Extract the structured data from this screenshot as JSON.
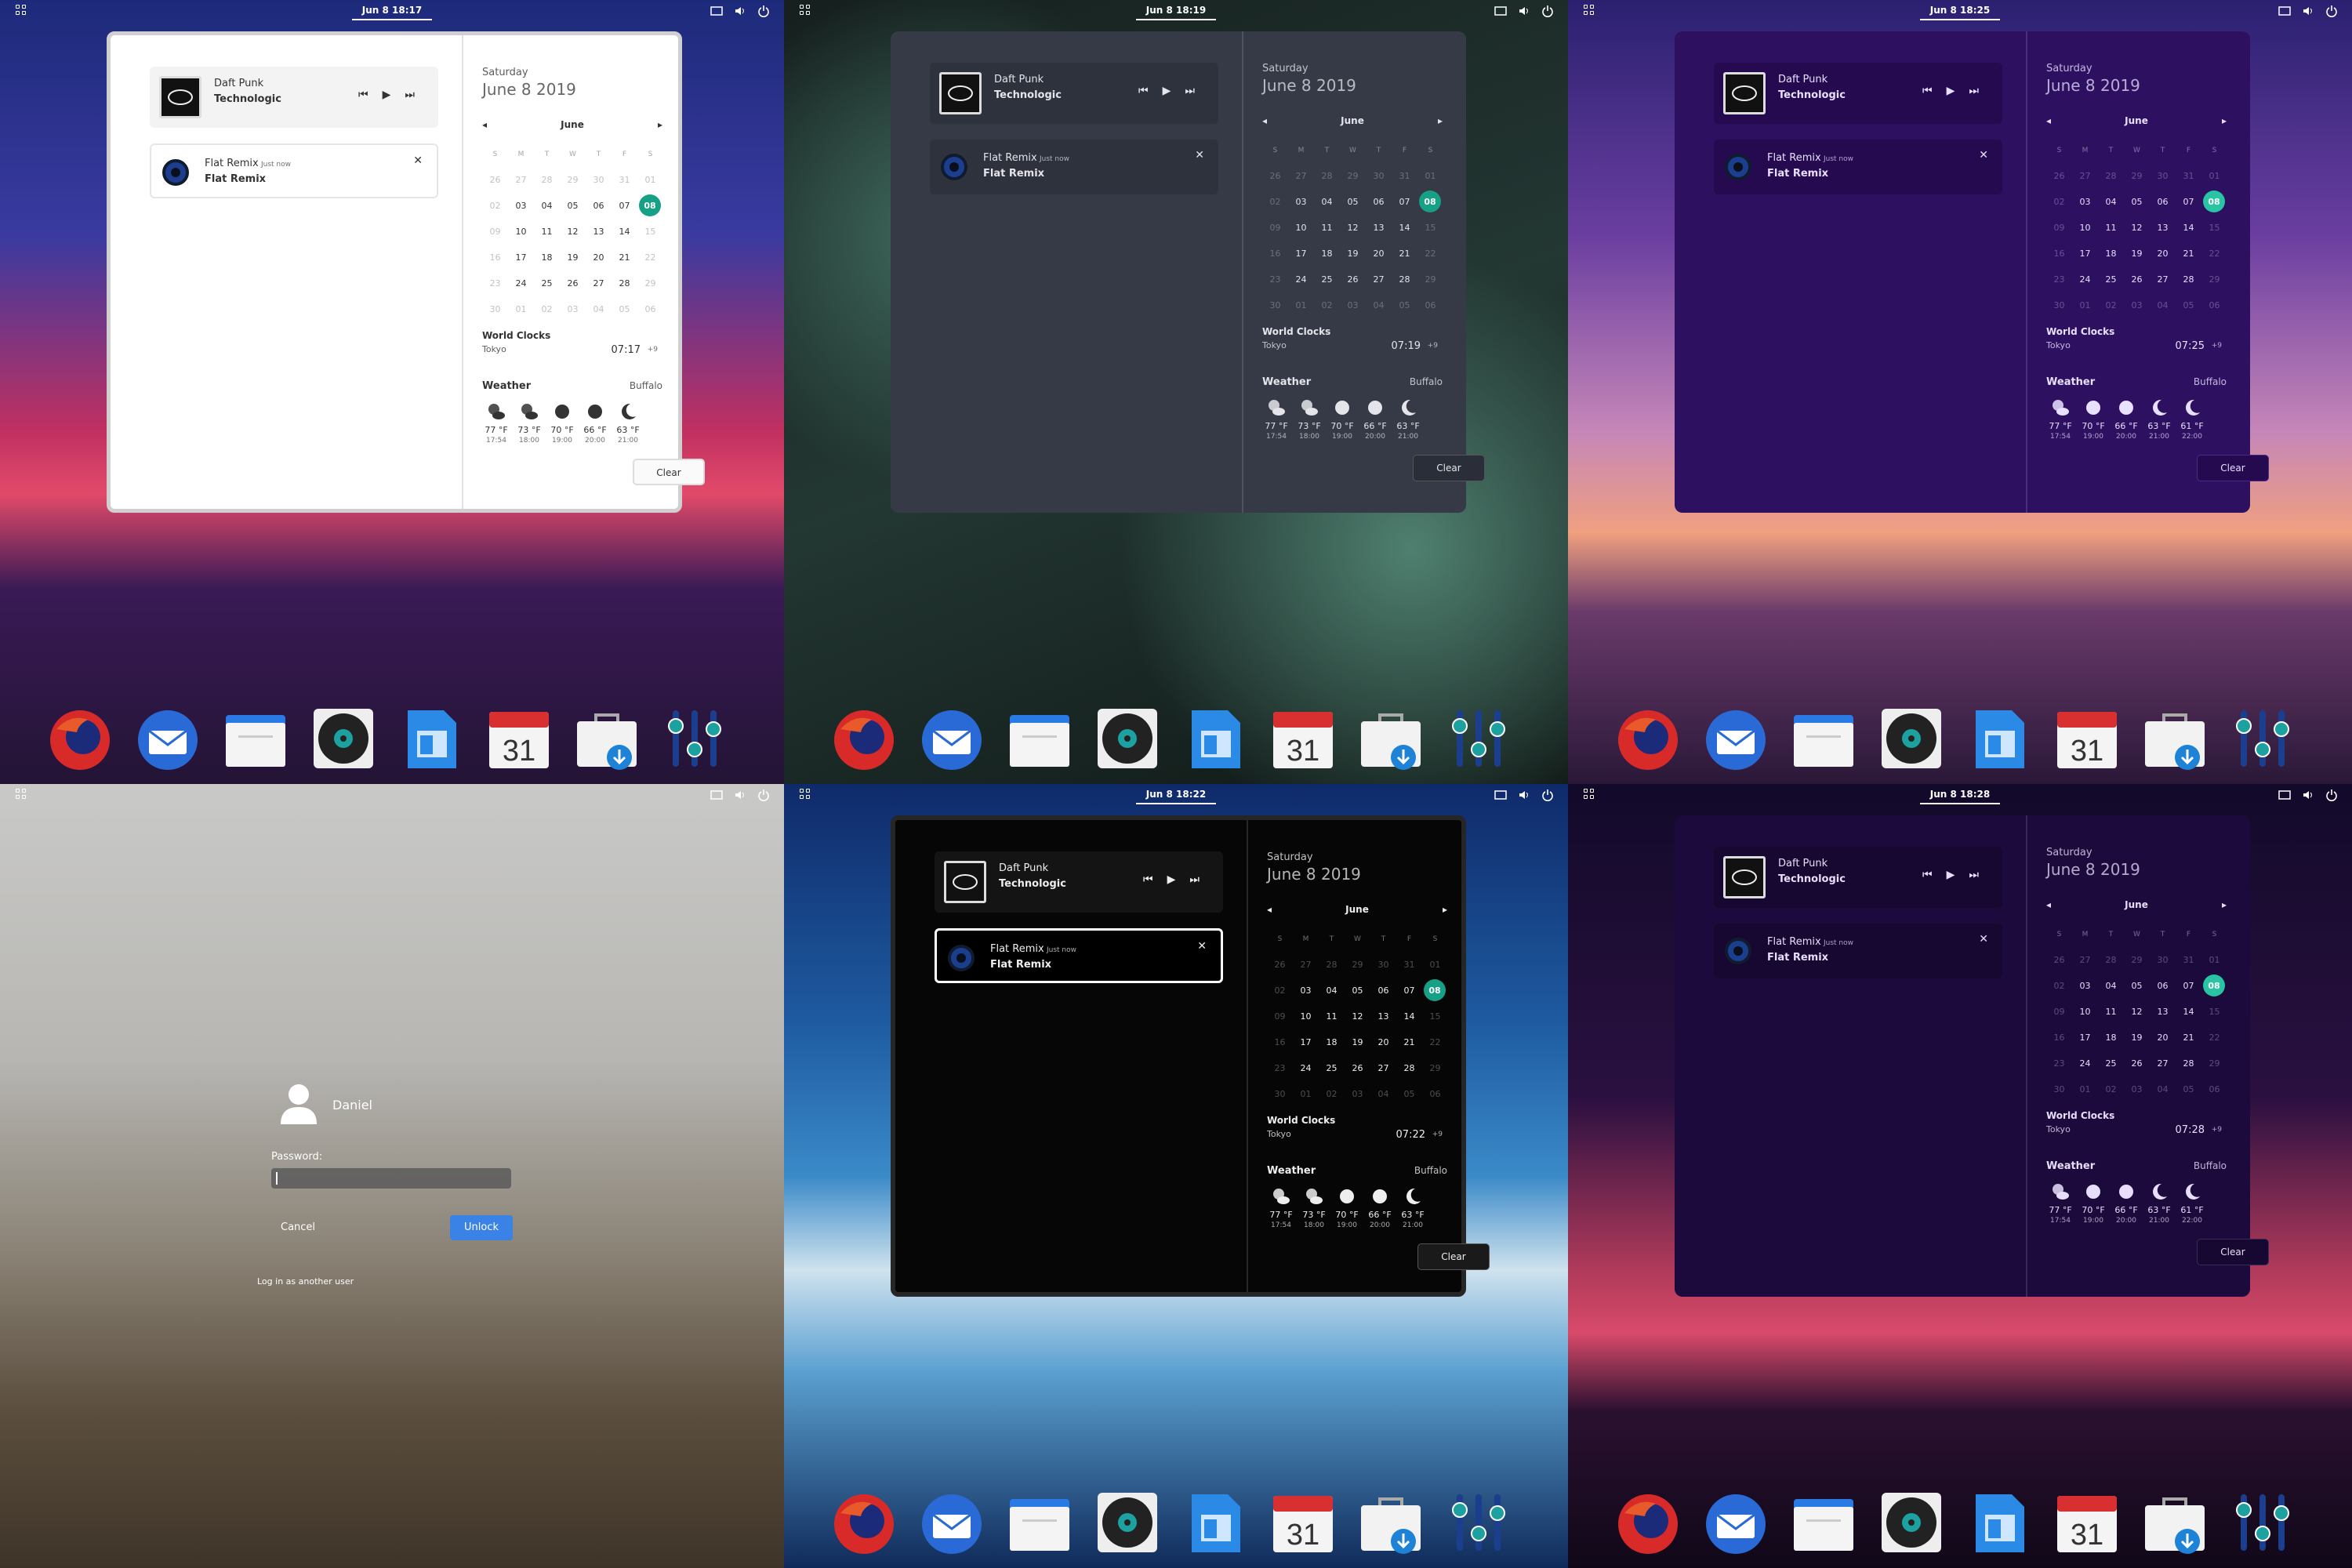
{
  "screens": [
    {
      "theme": "light",
      "clock": "Jun 8  18:17",
      "wc_time": "07:17",
      "weather": [
        {
          "icon": "cloud-sun",
          "temp": "77 °F",
          "hour": "17:54"
        },
        {
          "icon": "cloud-sun",
          "temp": "73 °F",
          "hour": "18:00"
        },
        {
          "icon": "sun",
          "temp": "70 °F",
          "hour": "19:00"
        },
        {
          "icon": "sun",
          "temp": "66 °F",
          "hour": "20:00"
        },
        {
          "icon": "moon",
          "temp": "63 °F",
          "hour": "21:00"
        }
      ]
    },
    {
      "theme": "gray",
      "clock": "Jun 8  18:19",
      "wc_time": "07:19",
      "weather": [
        {
          "icon": "cloud-sun",
          "temp": "77 °F",
          "hour": "17:54"
        },
        {
          "icon": "cloud-sun",
          "temp": "73 °F",
          "hour": "18:00"
        },
        {
          "icon": "sun",
          "temp": "70 °F",
          "hour": "19:00"
        },
        {
          "icon": "sun",
          "temp": "66 °F",
          "hour": "20:00"
        },
        {
          "icon": "moon",
          "temp": "63 °F",
          "hour": "21:00"
        }
      ]
    },
    {
      "theme": "purple",
      "clock": "Jun 8  18:25",
      "wc_time": "07:25",
      "weather": [
        {
          "icon": "cloud-sun",
          "temp": "77 °F",
          "hour": "17:54"
        },
        {
          "icon": "sun",
          "temp": "70 °F",
          "hour": "19:00"
        },
        {
          "icon": "sun",
          "temp": "66 °F",
          "hour": "20:00"
        },
        {
          "icon": "moon",
          "temp": "63 °F",
          "hour": "21:00"
        },
        {
          "icon": "moon",
          "temp": "61 °F",
          "hour": "22:00"
        }
      ]
    },
    {
      "theme": "lock"
    },
    {
      "theme": "black",
      "clock": "Jun 8  18:22",
      "wc_time": "07:22",
      "weather": [
        {
          "icon": "cloud-sun",
          "temp": "77 °F",
          "hour": "17:54"
        },
        {
          "icon": "cloud-sun",
          "temp": "73 °F",
          "hour": "18:00"
        },
        {
          "icon": "sun",
          "temp": "70 °F",
          "hour": "19:00"
        },
        {
          "icon": "sun",
          "temp": "66 °F",
          "hour": "20:00"
        },
        {
          "icon": "moon",
          "temp": "63 °F",
          "hour": "21:00"
        }
      ]
    },
    {
      "theme": "deep",
      "clock": "Jun 8  18:28",
      "wc_time": "07:28",
      "weather": [
        {
          "icon": "cloud-sun",
          "temp": "77 °F",
          "hour": "17:54"
        },
        {
          "icon": "sun",
          "temp": "70 °F",
          "hour": "19:00"
        },
        {
          "icon": "sun",
          "temp": "66 °F",
          "hour": "20:00"
        },
        {
          "icon": "moon",
          "temp": "63 °F",
          "hour": "21:00"
        },
        {
          "icon": "moon",
          "temp": "61 °F",
          "hour": "22:00"
        }
      ]
    }
  ],
  "media": {
    "artist": "Daft Punk",
    "title": "Technologic"
  },
  "notification": {
    "app": "Flat Remix",
    "time": "Just now",
    "body": "Flat Remix"
  },
  "calendar": {
    "day": "Saturday",
    "date": "June 8 2019",
    "month": "June",
    "weekdays": [
      "S",
      "M",
      "T",
      "W",
      "T",
      "F",
      "S"
    ],
    "days": [
      "26",
      "27",
      "28",
      "29",
      "30",
      "31",
      "01",
      "02",
      "03",
      "04",
      "05",
      "06",
      "07",
      "08",
      "09",
      "10",
      "11",
      "12",
      "13",
      "14",
      "15",
      "16",
      "17",
      "18",
      "19",
      "20",
      "21",
      "22",
      "23",
      "24",
      "25",
      "26",
      "27",
      "28",
      "29",
      "30",
      "01",
      "02",
      "03",
      "04",
      "05",
      "06"
    ],
    "dim_indices": [
      0,
      1,
      2,
      3,
      4,
      5,
      36,
      37,
      38,
      39,
      40,
      41
    ],
    "weekend_cols": [
      0,
      6
    ],
    "selected_index": 13
  },
  "world_clocks": {
    "title": "World Clocks",
    "city": "Tokyo",
    "offset": "+9"
  },
  "weather": {
    "title": "Weather",
    "location": "Buffalo"
  },
  "clear_label": "Clear",
  "dock": [
    "firefox-icon",
    "thunderbird-icon",
    "files-icon",
    "rhythmbox-icon",
    "writer-icon",
    "calendar-icon",
    "software-icon",
    "settings-icon"
  ],
  "dock_calendar_day": "31",
  "lock": {
    "user": "Daniel",
    "password_label": "Password:",
    "cancel": "Cancel",
    "unlock": "Unlock",
    "other_user": "Log in as another user"
  },
  "colors": {
    "accent": "#16a085",
    "unlock_blue": "#3b82e6"
  }
}
